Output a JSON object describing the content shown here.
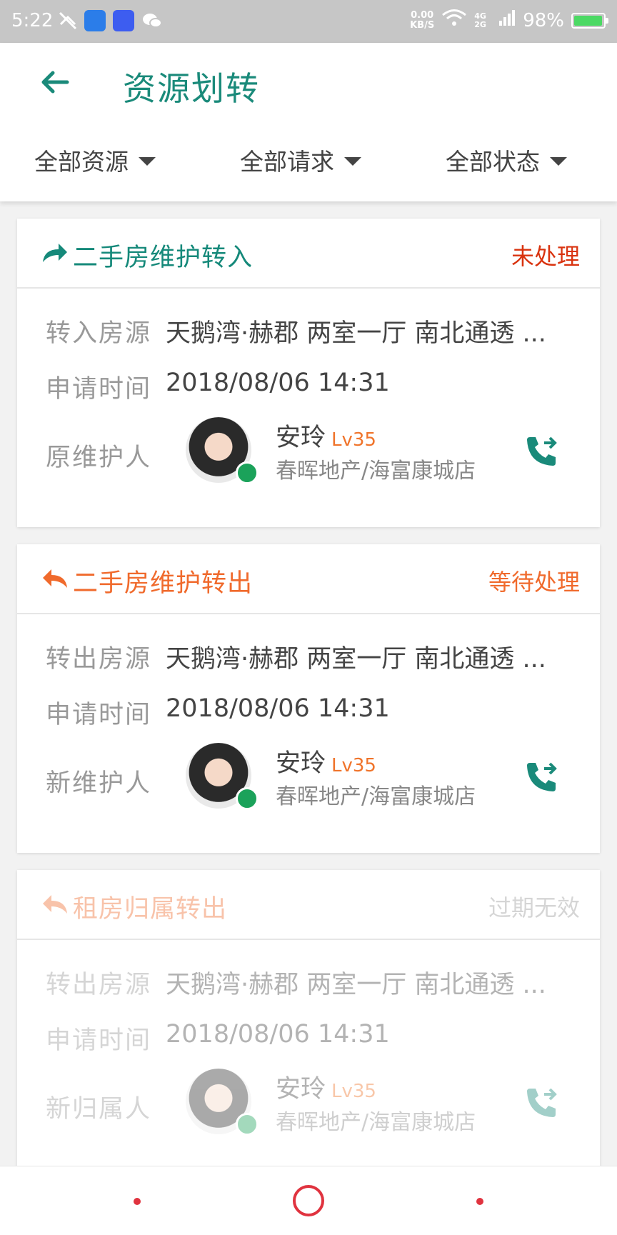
{
  "status_bar": {
    "time": "5:22",
    "net_speed": "0.00",
    "net_unit": "KB/S",
    "network": "4G 2G",
    "battery": "98%"
  },
  "header": {
    "title": "资源划转"
  },
  "filters": [
    {
      "label": "全部资源"
    },
    {
      "label": "全部请求"
    },
    {
      "label": "全部状态"
    }
  ],
  "cards": [
    {
      "type": "二手房维护转入",
      "status": "未处理",
      "type_color": "#15897a",
      "status_color": "#d9330f",
      "field1_label": "转入房源",
      "field1_value": "天鹅湾·赫郡 两室一厅 南北通透 ...",
      "time_label": "申请时间",
      "time_value": "2018/08/06 14:31",
      "person_label": "原维护人",
      "person_name": "安玲",
      "person_level": "Lv35",
      "person_store": "春晖地产/海富康城店"
    },
    {
      "type": "二手房维护转出",
      "status": "等待处理",
      "type_color": "#f06a2c",
      "status_color": "#f06a2c",
      "field1_label": "转出房源",
      "field1_value": "天鹅湾·赫郡 两室一厅 南北通透 ...",
      "time_label": "申请时间",
      "time_value": "2018/08/06 14:31",
      "person_label": "新维护人",
      "person_name": "安玲",
      "person_level": "Lv35",
      "person_store": "春晖地产/海富康城店"
    },
    {
      "type": "租房归属转出",
      "status": "过期无效",
      "type_color": "#f06a2c",
      "status_color": "#999999",
      "field1_label": "转出房源",
      "field1_value": "天鹅湾·赫郡 两室一厅 南北通透 ...",
      "time_label": "申请时间",
      "time_value": "2018/08/06 14:31",
      "person_label": "新归属人",
      "person_name": "安玲",
      "person_level": "Lv35",
      "person_store": "春晖地产/海富康城店"
    }
  ],
  "colors": {
    "accent": "#1a8a7a",
    "orange": "#f06a2c",
    "nav": "#e0333f"
  }
}
